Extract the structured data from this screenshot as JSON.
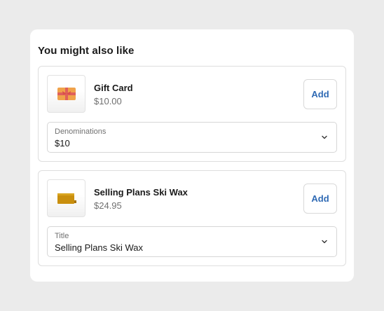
{
  "section": {
    "title": "You might also like"
  },
  "products": [
    {
      "name": "Gift Card",
      "price": "$10.00",
      "add_label": "Add",
      "option_label": "Denominations",
      "option_value": "$10",
      "icon": "gift-card-image"
    },
    {
      "name": "Selling Plans Ski Wax",
      "price": "$24.95",
      "add_label": "Add",
      "option_label": "Title",
      "option_value": "Selling Plans Ski Wax",
      "icon": "ski-wax-image"
    }
  ],
  "colors": {
    "page_background": "#ebebeb",
    "accent": "#2f6ab4",
    "muted_text": "#707070"
  }
}
